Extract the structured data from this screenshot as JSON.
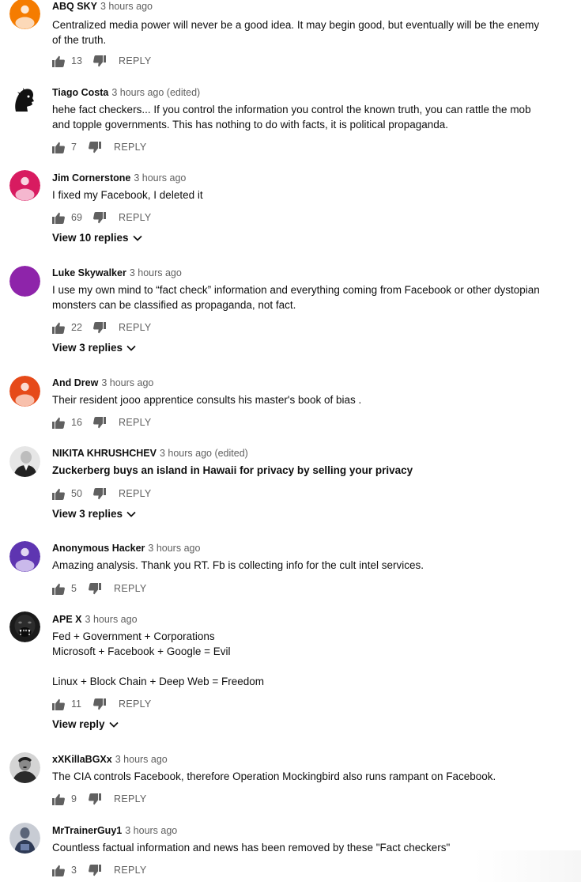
{
  "reply_label": "REPLY",
  "comments": [
    {
      "author": "ABQ SKY",
      "time": "3 hours ago",
      "text": "Centralized media power will never be a good idea. It may begin good,  but eventually will be the enemy of the truth.",
      "likes": "13",
      "avatar_color": "#f57c00",
      "avatar_icon": "default-person-icon"
    },
    {
      "author": "Tiago Costa",
      "time": "3 hours ago (edited)",
      "text": "hehe fact checkers... If you control the information you control the known truth, you can rattle the mob and topple governments. This has nothing to do with facts, it is political propaganda.",
      "likes": "7",
      "avatar_color": "#ffffff",
      "avatar_icon": "silhouette-profile-icon"
    },
    {
      "author": "Jim Cornerstone",
      "time": "3 hours ago",
      "text": "I fixed my Facebook, I deleted it",
      "likes": "69",
      "avatar_color": "#d81b60",
      "avatar_icon": "default-person-icon",
      "replies": "View 10 replies"
    },
    {
      "author": "Luke Skywalker",
      "time": "3 hours ago",
      "text": "I use my own mind to “fact check” information and everything coming from Facebook or other dystopian monsters can be classified as propaganda, not fact.",
      "likes": "22",
      "avatar_color": "#8e24aa",
      "avatar_icon": "plain-circle-icon",
      "replies": "View 3 replies"
    },
    {
      "author": "And Drew",
      "time": "3 hours ago",
      "text": "Their resident jooo  apprentice consults his master's book of bias .",
      "likes": "16",
      "avatar_color": "#e64a19",
      "avatar_icon": "default-person-icon"
    },
    {
      "author": "NIKITA KHRUSHCHEV",
      "time": "3 hours ago (edited)",
      "text": "Zuckerberg buys an island in Hawaii for privacy by selling your privacy",
      "likes": "50",
      "avatar_color": "#e0e0e0",
      "avatar_icon": "portrait-photo-icon",
      "replies": "View 3 replies",
      "bold_text": true
    },
    {
      "author": "Anonymous Hacker",
      "time": "3 hours ago",
      "text": "Amazing analysis. Thank you RT. Fb is collecting info for the cult intel services.",
      "likes": "5",
      "avatar_color": "#5e35b1",
      "avatar_icon": "default-person-icon"
    },
    {
      "author": "APE X",
      "time": "3 hours ago",
      "text": "Fed + Government + Corporations\nMicrosoft + Facebook + Google = Evil\n\nLinux + Block Chain + Deep Web = Freedom",
      "likes": "11",
      "avatar_color": "#1a1a1a",
      "avatar_icon": "gorilla-photo-icon",
      "replies": "View reply"
    },
    {
      "author": "xXKillaBGXx",
      "time": "3 hours ago",
      "text": "The CIA controls Facebook, therefore Operation Mockingbird also runs rampant on Facebook.",
      "likes": "9",
      "avatar_color": "#d9d9d9",
      "avatar_icon": "portrait-photo-icon"
    },
    {
      "author": "MrTrainerGuy1",
      "time": "3 hours ago",
      "text": "Countless factual information and news has been removed by these \"Fact checkers\"",
      "likes": "3",
      "avatar_color": "#c8ccd4",
      "avatar_icon": "person-photo-icon"
    }
  ]
}
